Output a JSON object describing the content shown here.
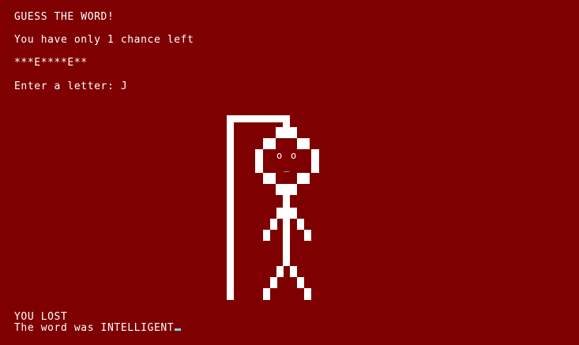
{
  "game": {
    "title": "GUESS THE WORD!",
    "chances_text": "You have only 1 chance left",
    "masked_word": "***E****E**",
    "prompt": "Enter a letter: J",
    "result": "YOU LOST",
    "reveal": "The word was INTELLIGENT",
    "wrong_guesses_remaining": 1
  },
  "colors": {
    "background": "#7f0000",
    "foreground": "#ffffff",
    "cursor": "#7ad7e0"
  },
  "hangman": {
    "left_eye": "o",
    "right_eye": "o",
    "mouth": "_"
  }
}
